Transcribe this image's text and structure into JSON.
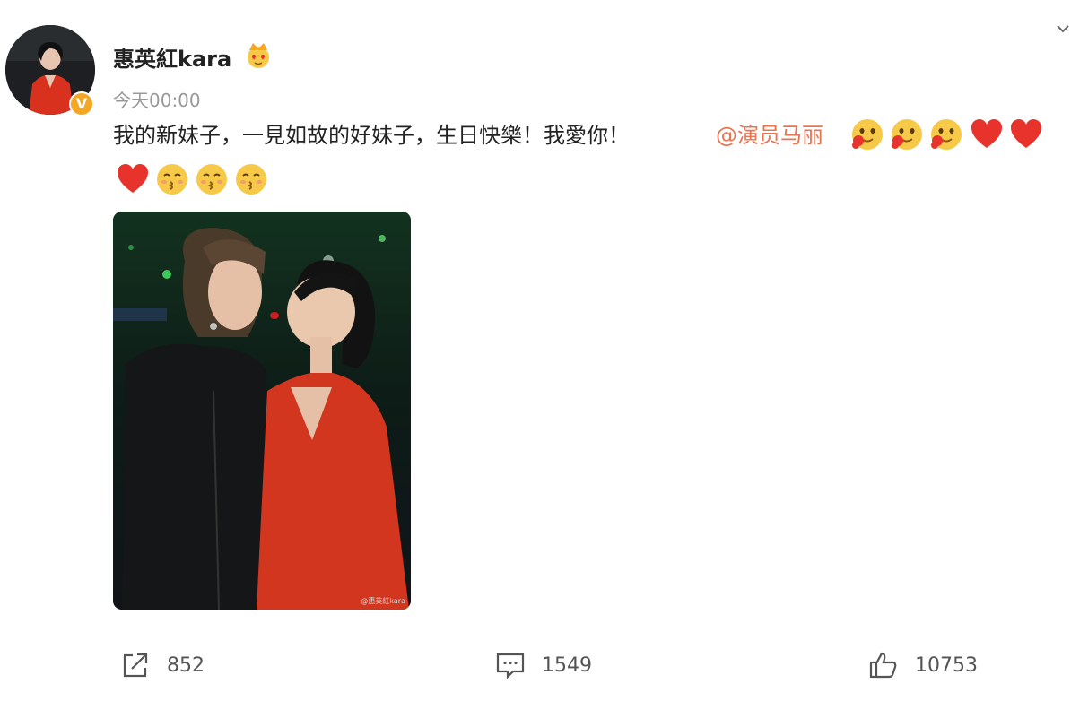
{
  "post": {
    "username": "惠英紅kara",
    "timestamp": "今天00:00",
    "text": "我的新妹子，一見如故的好妹子，生日快樂！我愛你！",
    "mention": "@演员马丽",
    "verified_badge": "V",
    "image_watermark": "@惠英紅kara"
  },
  "emojis": {
    "line1": [
      "blush-hearts-emoji",
      "blush-hearts-emoji",
      "blush-hearts-emoji",
      "red-heart-emoji",
      "red-heart-emoji"
    ],
    "line2": [
      "red-heart-emoji",
      "kissing-emoji",
      "kissing-emoji",
      "kissing-emoji"
    ]
  },
  "actions": {
    "share_count": "852",
    "comment_count": "1549",
    "like_count": "10753"
  },
  "colors": {
    "mention": "#eb7350",
    "badge": "#f5a623",
    "heart": "#e8322c",
    "emoji_face": "#f7c948"
  }
}
